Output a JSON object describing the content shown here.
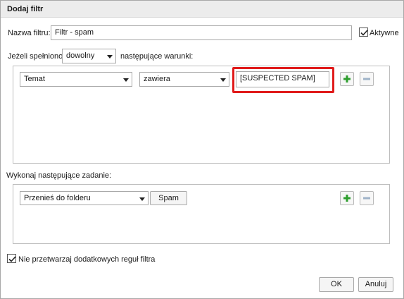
{
  "window": {
    "title": "Dodaj filtr"
  },
  "filter_name": {
    "label": "Nazwa filtru:",
    "value": "Filtr - spam"
  },
  "active": {
    "label": "Aktywne",
    "checked": true
  },
  "conditions": {
    "prefix_label": "Jeżeli spełniono",
    "match_value": "dowolny",
    "suffix_label": "następujące warunki:",
    "rule": {
      "field": "Temat",
      "operator": "zawiera",
      "value": "[SUSPECTED SPAM]"
    }
  },
  "actions": {
    "label": "Wykonaj następujące zadanie:",
    "rule": {
      "action": "Przenieś do folderu",
      "target": "Spam"
    }
  },
  "stop_processing": {
    "label": "Nie przetwarzaj dodatkowych reguł filtra",
    "checked": true
  },
  "buttons": {
    "ok": "OK",
    "cancel": "Anuluj"
  },
  "colors": {
    "highlight": "#e01b1b",
    "add_icon": "#2e9e2e",
    "remove_icon": "#9fb3c8"
  }
}
